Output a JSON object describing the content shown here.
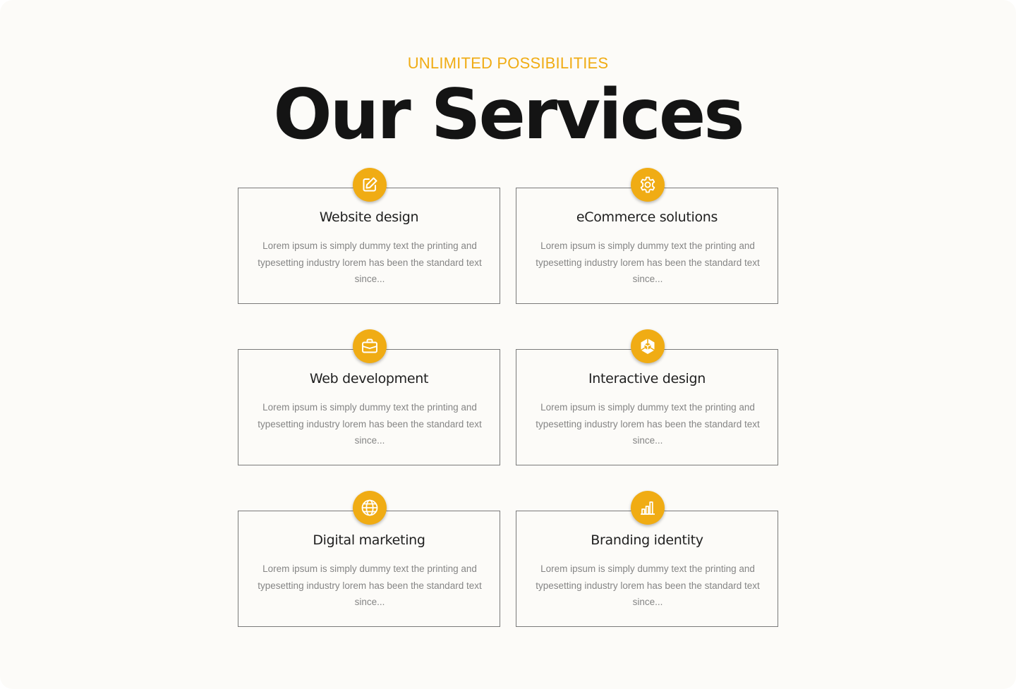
{
  "header": {
    "eyebrow": "UNLIMITED POSSIBILITIES",
    "title": "Our Services"
  },
  "theme": {
    "accent": "#f0ac14",
    "background": "#fcfbf8",
    "title_color": "#141414",
    "body_text_color": "#858585"
  },
  "services": [
    {
      "icon": "pencil-square-icon",
      "title": "Website design",
      "description": "Lorem ipsum is simply dummy text the printing and typesetting industry lorem has been the standard text since..."
    },
    {
      "icon": "gear-icon",
      "title": "eCommerce solutions",
      "description": "Lorem ipsum is simply dummy text the printing and typesetting industry lorem has been the standard text since..."
    },
    {
      "icon": "briefcase-icon",
      "title": "Web development",
      "description": "Lorem ipsum is simply dummy text the printing and typesetting industry lorem has been the standard text since..."
    },
    {
      "icon": "unity-cube-icon",
      "title": "Interactive design",
      "description": "Lorem ipsum is simply dummy text the printing and typesetting industry lorem has been the standard text since..."
    },
    {
      "icon": "globe-icon",
      "title": "Digital marketing",
      "description": "Lorem ipsum is simply dummy text the printing and typesetting industry lorem has been the standard text since..."
    },
    {
      "icon": "bar-chart-icon",
      "title": "Branding identity",
      "description": "Lorem ipsum is simply dummy text the printing and typesetting industry lorem has been the standard text since..."
    }
  ]
}
